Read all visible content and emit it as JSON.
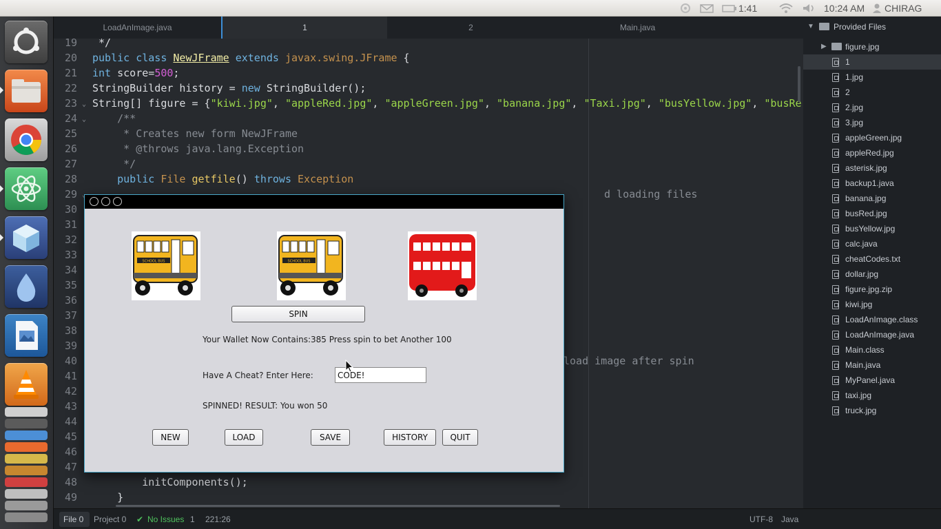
{
  "topbar": {
    "battery_time": "1:41",
    "clock": "10:24 AM",
    "user": "CHIRAG",
    "icons": [
      "settings-icon",
      "mail-icon",
      "battery-icon",
      "wifi-icon",
      "volume-icon",
      "user-icon"
    ]
  },
  "launcher": {
    "apps": [
      "ubuntu-dash-icon",
      "files-icon",
      "chrome-icon",
      "atom-icon",
      "box-app-icon",
      "drop-app-icon",
      "impress-icon",
      "vlc-icon"
    ]
  },
  "editor": {
    "tabs": [
      {
        "label": "LoadAnImage.java",
        "active": false
      },
      {
        "label": "1",
        "active": true
      },
      {
        "label": "2",
        "active": false
      },
      {
        "label": "Main.java",
        "active": false
      }
    ],
    "line_numbers": [
      "19",
      "20",
      "21",
      "22",
      "23",
      "24",
      "25",
      "26",
      "27",
      "28",
      "29",
      "30",
      "31",
      "32",
      "33",
      "34",
      "35",
      "36",
      "37",
      "38",
      "39",
      "40",
      "41",
      "42",
      "43",
      "44",
      "45",
      "46",
      "47",
      "48",
      "49"
    ],
    "fold_lines": [
      "23",
      "24",
      "29"
    ],
    "lines": {
      "l19": " */",
      "l20_kw": "public class ",
      "l20_cls": "NewJFrame",
      "l20_ext": " extends ",
      "l20_ty": "javax.swing.JFrame",
      "l20_end": " {",
      "l21_kw": "int",
      "l21_a": " score=",
      "l21_num": "500",
      "l21_end": ";",
      "l22_a": "StringBuilder history = ",
      "l22_kw": "new",
      "l22_b": " StringBuilder();",
      "l23_a": "String[] figure = {",
      "l23_s1": "\"kiwi.jpg\"",
      "l23_s2": "\"appleRed.jpg\"",
      "l23_s3": "\"appleGreen.jpg\"",
      "l23_s4": "\"banana.jpg\"",
      "l23_s5": "\"Taxi.jpg\"",
      "l23_s6": "\"busYellow.jpg\"",
      "l23_s7": "\"busRe",
      "l24": "    /**",
      "l25": "     * Creates new form NewJFrame",
      "l26": "     * @throws java.lang.Exception",
      "l27": "     */",
      "l28_kw": "    public",
      "l28_ty": "File",
      "l28_fn": "getfile",
      "l28_a": "() ",
      "l28_kw2": "throws",
      "l28_ty2": "Exception",
      "l29_cm": "d loading files",
      "l40_cm": "load image after spin",
      "l48": "        initComponents();",
      "l49": "    }"
    }
  },
  "tree": {
    "root": "Provided Files",
    "items": [
      {
        "label": "figure.jpg",
        "kind": "folder"
      },
      {
        "label": "1",
        "kind": "file",
        "selected": true
      },
      {
        "label": "1.jpg",
        "kind": "file"
      },
      {
        "label": "2",
        "kind": "file"
      },
      {
        "label": "2.jpg",
        "kind": "file"
      },
      {
        "label": "3.jpg",
        "kind": "file"
      },
      {
        "label": "appleGreen.jpg",
        "kind": "file"
      },
      {
        "label": "appleRed.jpg",
        "kind": "file"
      },
      {
        "label": "asterisk.jpg",
        "kind": "file"
      },
      {
        "label": "backup1.java",
        "kind": "file"
      },
      {
        "label": "banana.jpg",
        "kind": "file"
      },
      {
        "label": "busRed.jpg",
        "kind": "file"
      },
      {
        "label": "busYellow.jpg",
        "kind": "file"
      },
      {
        "label": "calc.java",
        "kind": "file"
      },
      {
        "label": "cheatCodes.txt",
        "kind": "file"
      },
      {
        "label": "dollar.jpg",
        "kind": "file"
      },
      {
        "label": "figure.jpg.zip",
        "kind": "file"
      },
      {
        "label": "kiwi.jpg",
        "kind": "file"
      },
      {
        "label": "LoadAnImage.class",
        "kind": "file"
      },
      {
        "label": "LoadAnImage.java",
        "kind": "file"
      },
      {
        "label": "Main.class",
        "kind": "file"
      },
      {
        "label": "Main.java",
        "kind": "file"
      },
      {
        "label": "MyPanel.java",
        "kind": "file"
      },
      {
        "label": "taxi.jpg",
        "kind": "file"
      },
      {
        "label": "truck.jpg",
        "kind": "file"
      }
    ]
  },
  "status": {
    "file": "File 0",
    "project": "Project 0",
    "issues": "No Issues",
    "line": "1",
    "cursor": "221:26",
    "encoding": "UTF-8",
    "grammar": "Java"
  },
  "dialog": {
    "slots": [
      "school-bus-image",
      "school-bus-image",
      "red-double-decker-bus-image"
    ],
    "bus_sign": "SCHOOL BUS",
    "spin_label": "SPIN",
    "wallet_text": "Your Wallet Now Contains:385 Press spin to bet Another 100",
    "cheat_label": "Have A Cheat? Enter Here:",
    "cheat_value": "CODE!",
    "result_text": "SPINNED! RESULT: You won 50",
    "buttons": {
      "new": "NEW",
      "load": "LOAD",
      "save": "SAVE",
      "history": "HISTORY",
      "quit": "QUIT"
    }
  }
}
